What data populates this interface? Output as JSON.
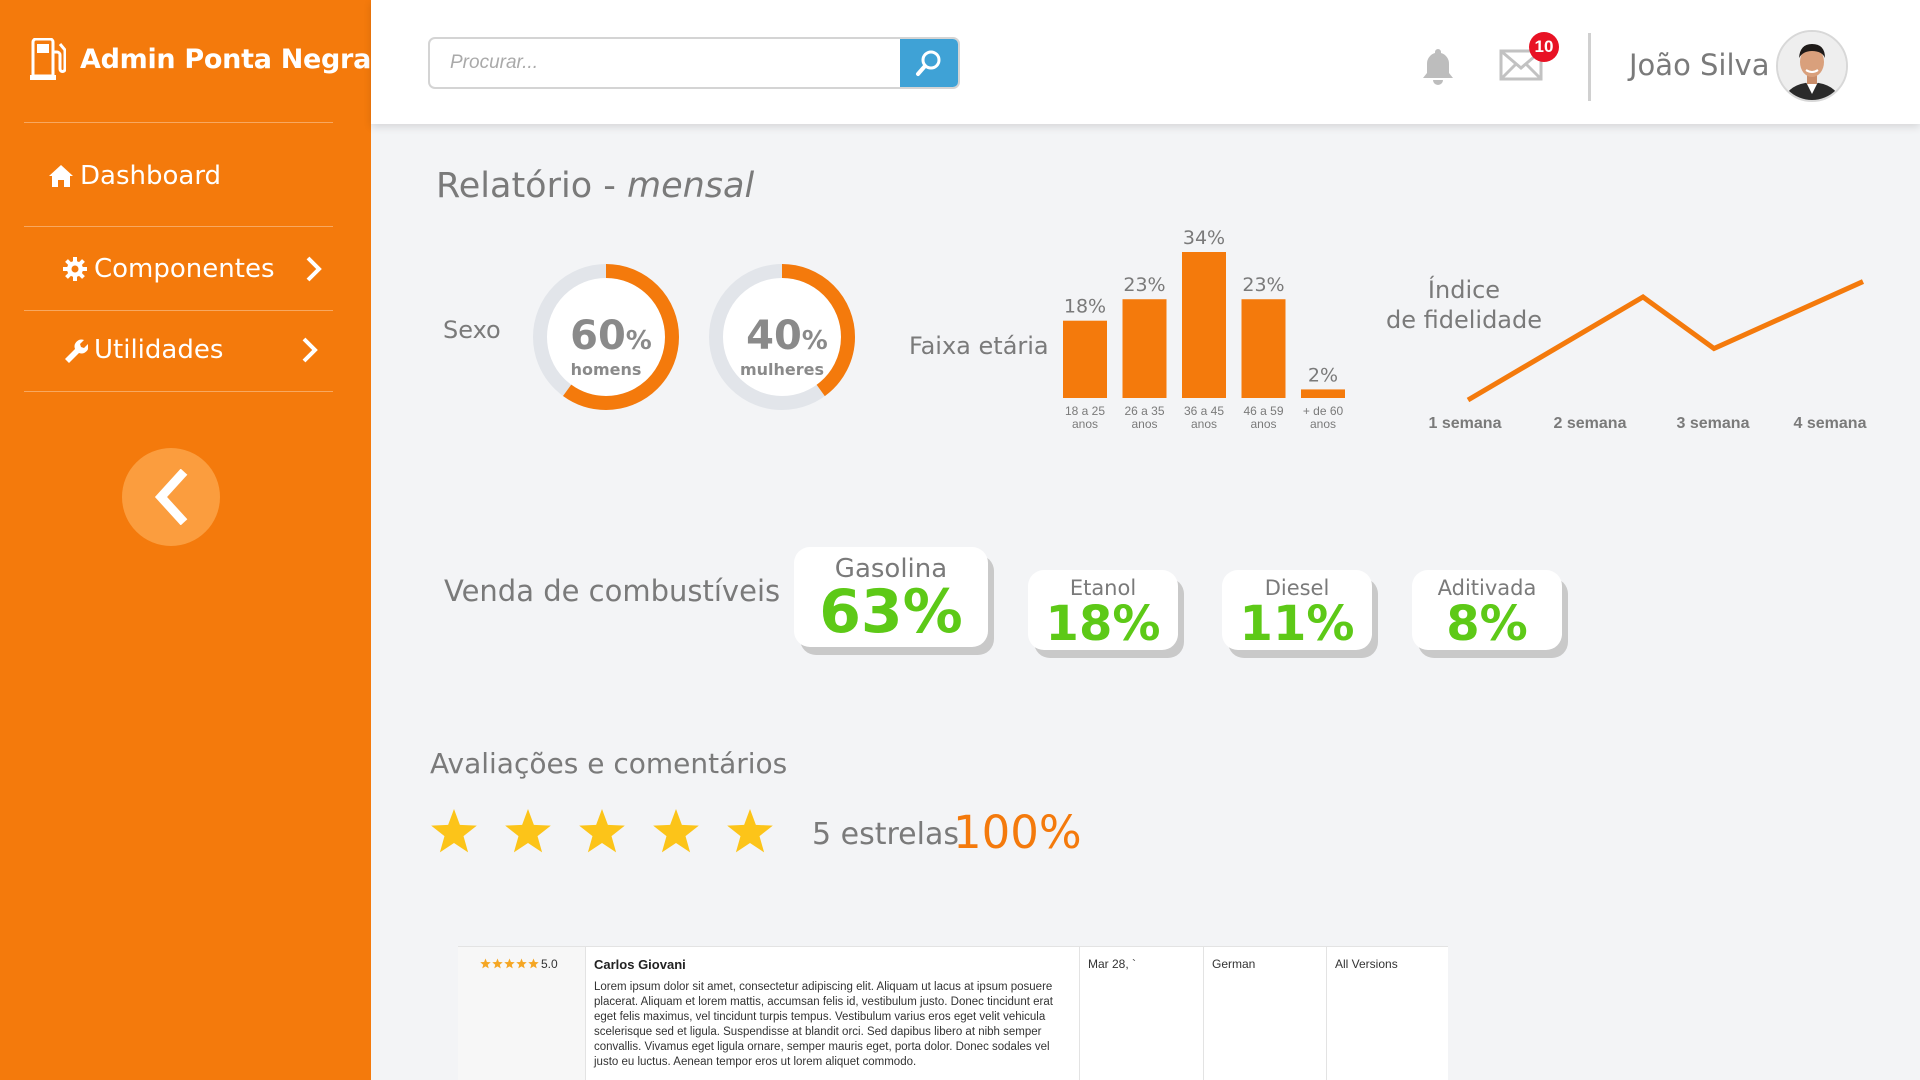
{
  "colors": {
    "accent": "#f47a0c",
    "green": "#5dc917",
    "blue": "#3fa2d6",
    "badge": "#e81224"
  },
  "sidebar": {
    "brand": "Admin Ponta Negra",
    "items": [
      {
        "label": "Dashboard",
        "icon": "home-icon"
      },
      {
        "label": "Componentes",
        "icon": "gear-icon"
      },
      {
        "label": "Utilidades",
        "icon": "wrench-icon"
      }
    ]
  },
  "topbar": {
    "search_placeholder": "Procurar...",
    "notifications_count": "10",
    "user_name": "João Silva"
  },
  "report": {
    "title": "Relatório - ",
    "title_em": "mensal",
    "sexo": {
      "label": "Sexo",
      "men": {
        "value": "60",
        "unit": "%",
        "label": "homens",
        "fraction": 0.6
      },
      "women": {
        "value": "40",
        "unit": "%",
        "label": "mulheres",
        "fraction": 0.4
      }
    },
    "age": {
      "label": "Faixa etária"
    },
    "loyalty": {
      "label_line1": "Índice",
      "label_line2": "de fidelidade"
    }
  },
  "chart_data": [
    {
      "type": "bar",
      "categories": [
        "18 a 25 anos",
        "26 a 35 anos",
        "36 a 45 anos",
        "46 a 59 anos",
        "+ de 60 anos"
      ],
      "category_lines": [
        [
          "18 a 25",
          "anos"
        ],
        [
          "26 a 35",
          "anos"
        ],
        [
          "36 a 45",
          "anos"
        ],
        [
          "46 a 59",
          "anos"
        ],
        [
          "+ de 60",
          "anos"
        ]
      ],
      "values": [
        18,
        23,
        34,
        23,
        2
      ],
      "labels": [
        "18%",
        "23%",
        "34%",
        "23%",
        "2%"
      ],
      "ylim": [
        0,
        34
      ]
    },
    {
      "type": "line",
      "categories": [
        "1 semana",
        "2 semana",
        "3 semana",
        "4 semana"
      ],
      "values": [
        1,
        3,
        2,
        3.3
      ]
    }
  ],
  "fuel": {
    "label": "Venda de combustíveis",
    "items": [
      {
        "name": "Gasolina",
        "value": "63%"
      },
      {
        "name": "Etanol",
        "value": "18%"
      },
      {
        "name": "Diesel",
        "value": "11%"
      },
      {
        "name": "Aditivada",
        "value": "8%"
      }
    ]
  },
  "reviews": {
    "title": "Avaliações e comentários",
    "stars": 5,
    "stars_text": "5 estrelas",
    "stars_pct": "100%",
    "row": {
      "rating": "5.0",
      "author": "Carlos Giovani",
      "text": "Lorem ipsum dolor sit amet, consectetur adipiscing elit. Aliquam ut lacus at ipsum posuere placerat. Aliquam et lorem mattis, accumsan felis id, vestibulum justo. Donec tincidunt erat eget felis maximus, vel tincidunt turpis tempus. Vestibulum varius eros eget velit vehicula scelerisque sed et ligula. Suspendisse at blandit orci. Sed dapibus libero at nibh semper convallis. Vivamus eget ligula ornare, semper mauris eget, porta dolor. Donec sodales vel justo eu luctus. Aenean tempor eros ut lorem aliquet commodo.",
      "date": "Mar 28, `",
      "language": "German",
      "version": "All Versions"
    }
  }
}
